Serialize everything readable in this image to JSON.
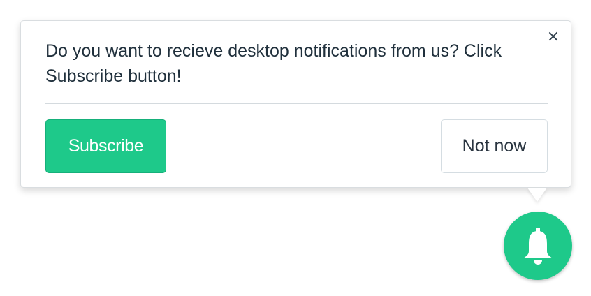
{
  "popup": {
    "message": "Do you want to recieve desktop notifications from us? Click Subscribe button!",
    "close_label": "×",
    "subscribe_label": "Subscribe",
    "not_now_label": "Not now"
  },
  "bell": {
    "icon": "bell-icon"
  },
  "colors": {
    "accent": "#1ec98a",
    "text": "#20303c",
    "border": "#d5dde2"
  }
}
